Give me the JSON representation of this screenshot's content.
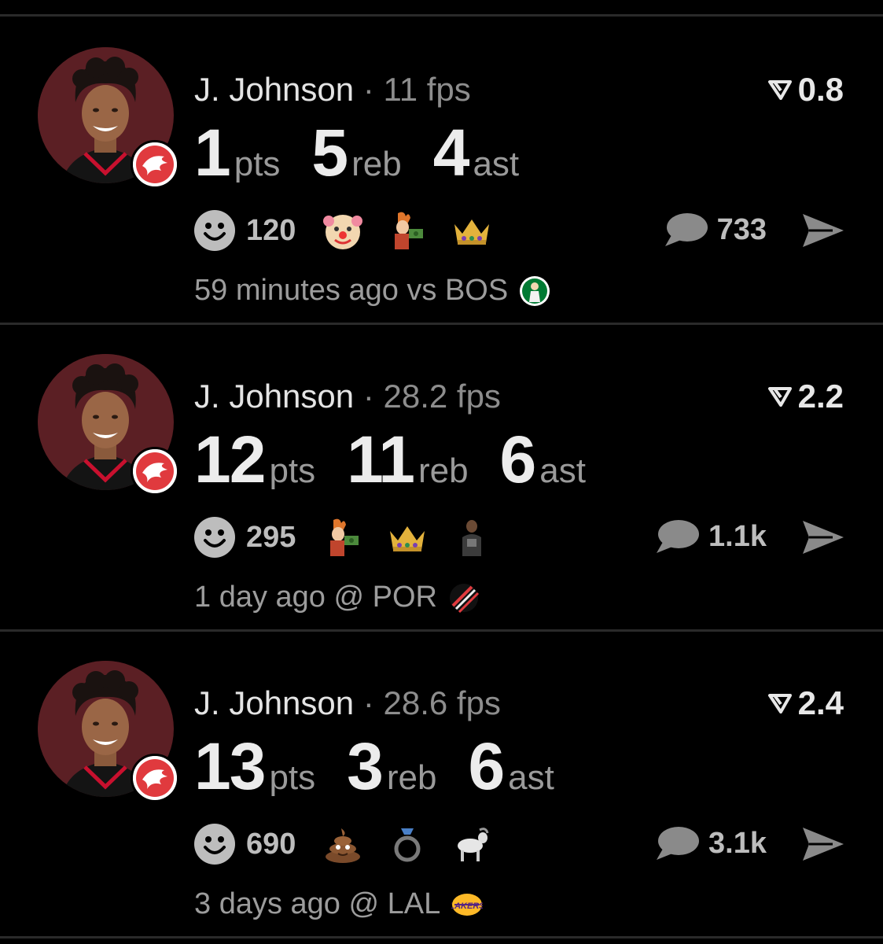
{
  "feed": {
    "cards": [
      {
        "player_name": "J. Johnson",
        "separator": "·",
        "fps": "11 fps",
        "rating": "0.8",
        "stats": [
          {
            "value": "1",
            "unit": "pts"
          },
          {
            "value": "5",
            "unit": "reb"
          },
          {
            "value": "4",
            "unit": "ast"
          }
        ],
        "reaction_count": "120",
        "reaction_emojis": [
          "clown",
          "fry-money",
          "crown"
        ],
        "comment_count": "733",
        "time_ago": "59 minutes ago vs BOS",
        "opponent_logo": "celtics-logo"
      },
      {
        "player_name": "J. Johnson",
        "separator": "·",
        "fps": "28.2 fps",
        "rating": "2.2",
        "stats": [
          {
            "value": "12",
            "unit": "pts"
          },
          {
            "value": "11",
            "unit": "reb"
          },
          {
            "value": "6",
            "unit": "ast"
          }
        ],
        "reaction_count": "295",
        "reaction_emojis": [
          "fry-money",
          "crown",
          "player"
        ],
        "comment_count": "1.1k",
        "time_ago": "1 day ago @ POR",
        "opponent_logo": "blazers-logo"
      },
      {
        "player_name": "J. Johnson",
        "separator": "·",
        "fps": "28.6 fps",
        "rating": "2.4",
        "stats": [
          {
            "value": "13",
            "unit": "pts"
          },
          {
            "value": "3",
            "unit": "reb"
          },
          {
            "value": "6",
            "unit": "ast"
          }
        ],
        "reaction_count": "690",
        "reaction_emojis": [
          "poop",
          "ring",
          "goat"
        ],
        "comment_count": "3.1k",
        "time_ago": "3 days ago @ LAL",
        "opponent_logo": "lakers-logo"
      }
    ]
  },
  "colors": {
    "background": "#000000",
    "divider": "#2a2a2a",
    "muted_text": "#9c9c9c",
    "team_red": "#e03a3e"
  }
}
